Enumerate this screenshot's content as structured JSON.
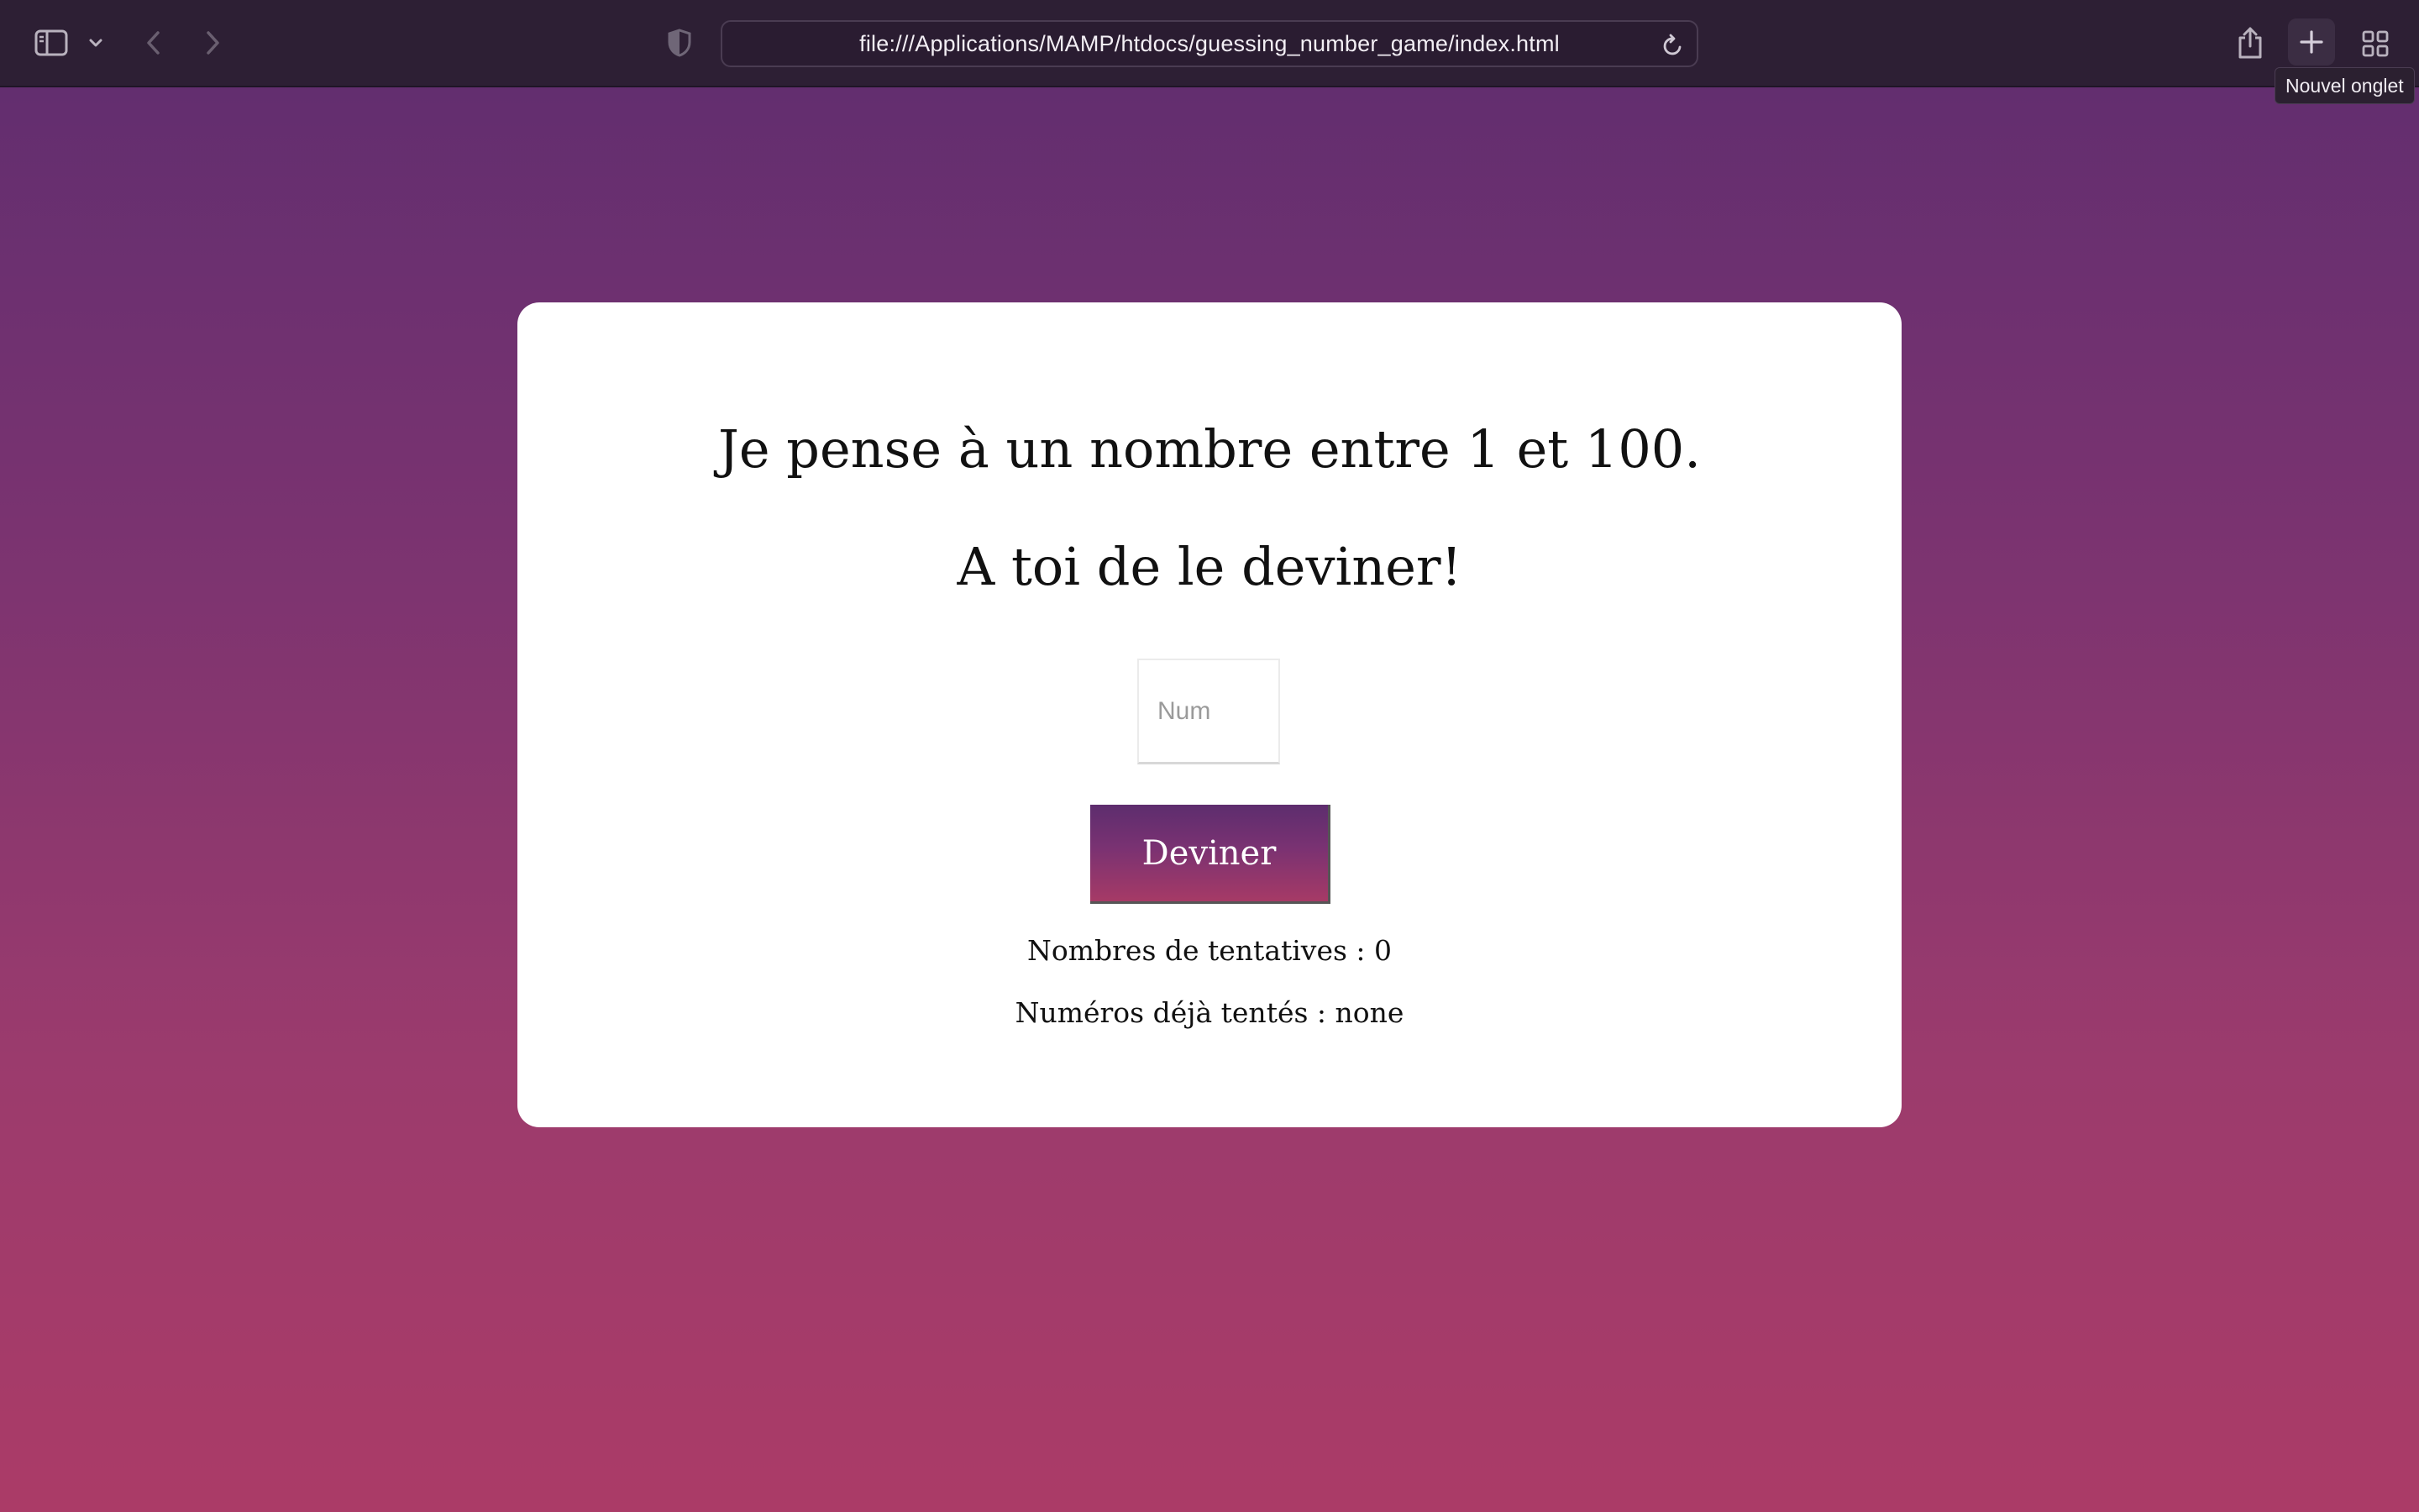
{
  "browser": {
    "url": "file:///Applications/MAMP/htdocs/guessing_number_game/index.html",
    "tooltip": "Nouvel onglet",
    "icons": {
      "sidebar": "sidebar-icon",
      "sidebar_menu": "chevron-down-icon",
      "back": "chevron-left-icon",
      "forward": "chevron-right-icon",
      "privacy": "shield-icon",
      "reload": "reload-icon",
      "share": "share-icon",
      "new_tab": "plus-icon",
      "tab_overview": "grid-icon"
    }
  },
  "game": {
    "heading_line1": "Je pense à un nombre entre 1 et 100.",
    "heading_line2": "A toi de le deviner!",
    "input_placeholder": "Num",
    "input_value": "",
    "guess_button": "Deviner",
    "attempts_text": "Nombres de tentatives : 0",
    "tried_text": "Numéros déjà tentés : none"
  },
  "colors": {
    "background_top": "#5e2d6f",
    "background_bottom": "#ab3b67",
    "toolbar": "#2d1f34",
    "card": "#ffffff",
    "button_top": "#5d2d6e",
    "button_bottom": "#a63a66"
  }
}
